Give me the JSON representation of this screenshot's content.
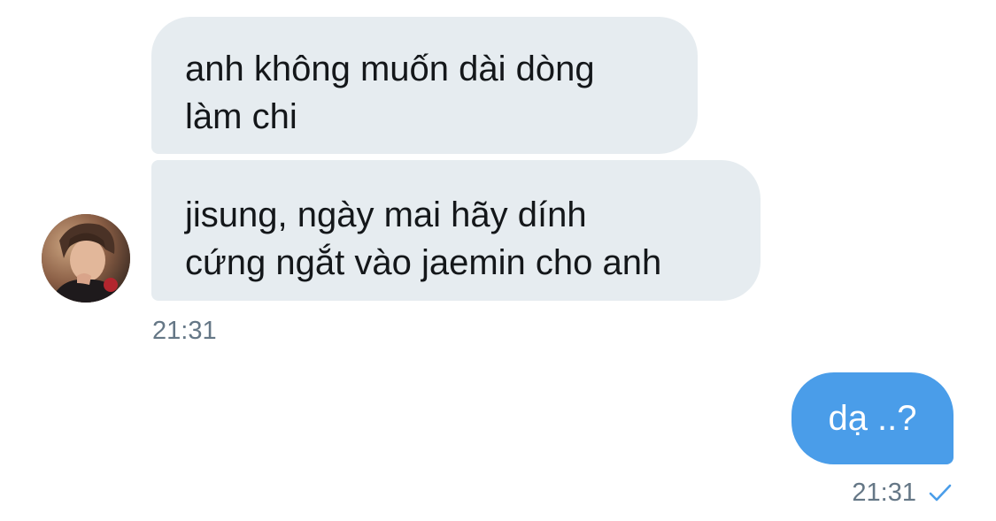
{
  "conversation": {
    "incoming": {
      "messages": [
        {
          "text": "anh không muốn dài dòng\nlàm chi"
        },
        {
          "text": "jisung, ngày mai hãy dính\ncứng ngắt vào jaemin cho anh"
        }
      ],
      "time": "21:31",
      "avatar_icon": "user-avatar-photo"
    },
    "outgoing": {
      "messages": [
        {
          "text": "dạ ..?"
        }
      ],
      "time": "21:31",
      "status_icon": "check-icon"
    }
  },
  "colors": {
    "incoming_bubble": "#e6ecf0",
    "outgoing_bubble": "#4a9de9",
    "timestamp": "#657786",
    "check": "#4a9de9"
  }
}
